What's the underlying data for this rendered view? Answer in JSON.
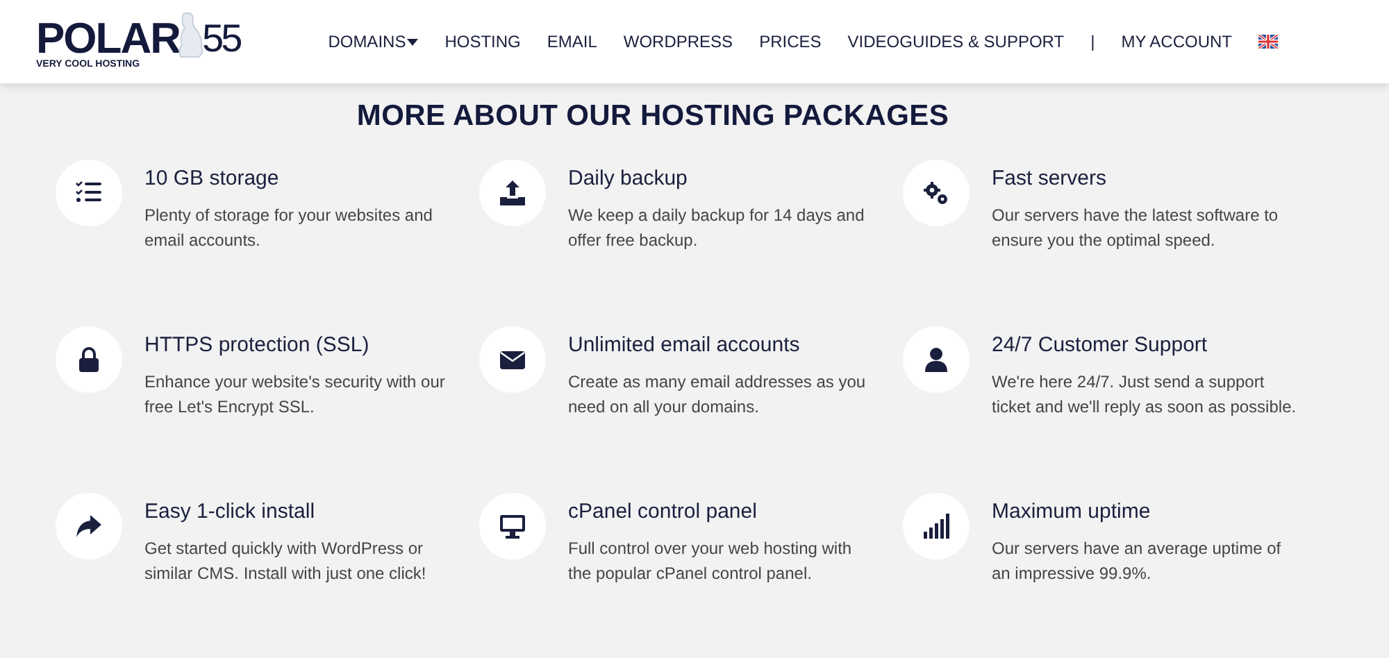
{
  "logo": {
    "wordmark": "POLAR",
    "number": "55",
    "tagline": "VERY COOL HOSTING"
  },
  "nav": [
    {
      "label": "DOMAINS",
      "dropdown": true
    },
    {
      "label": "HOSTING",
      "dropdown": false
    },
    {
      "label": "EMAIL",
      "dropdown": false
    },
    {
      "label": "WORDPRESS",
      "dropdown": false
    },
    {
      "label": "PRICES",
      "dropdown": false
    },
    {
      "label": "VIDEOGUIDES & SUPPORT",
      "dropdown": false
    },
    {
      "label": "|",
      "dropdown": false
    },
    {
      "label": "MY ACCOUNT",
      "dropdown": false
    }
  ],
  "heading": "MORE ABOUT OUR HOSTING PACKAGES",
  "features": [
    {
      "kind": "checklist",
      "title": "10 GB storage",
      "text": "Plenty of storage for your websites and email accounts."
    },
    {
      "kind": "upload",
      "title": "Daily backup",
      "text": "We keep a daily backup for 14 days and offer free backup."
    },
    {
      "kind": "gears",
      "title": "Fast servers",
      "text": "Our servers have the latest software to ensure you the optimal speed."
    },
    {
      "kind": "lock",
      "title": "HTTPS protection (SSL)",
      "text": "Enhance your website's security with our free Let's Encrypt SSL."
    },
    {
      "kind": "envelope",
      "title": "Unlimited email accounts",
      "text": "Create as many email addresses as you need on all your domains."
    },
    {
      "kind": "user",
      "title": "24/7 Customer Support",
      "text": "We're here 24/7. Just send a support ticket and we'll reply as soon as possible."
    },
    {
      "kind": "share",
      "title": "Easy 1-click install",
      "text": "Get started quickly with WordPress or similar CMS. Install with just one click!"
    },
    {
      "kind": "monitor",
      "title": "cPanel control panel",
      "text": "Full control over your web hosting with the popular cPanel control panel."
    },
    {
      "kind": "bars",
      "title": "Maximum uptime",
      "text": "Our servers have an average uptime of an impressive 99.9%."
    }
  ]
}
